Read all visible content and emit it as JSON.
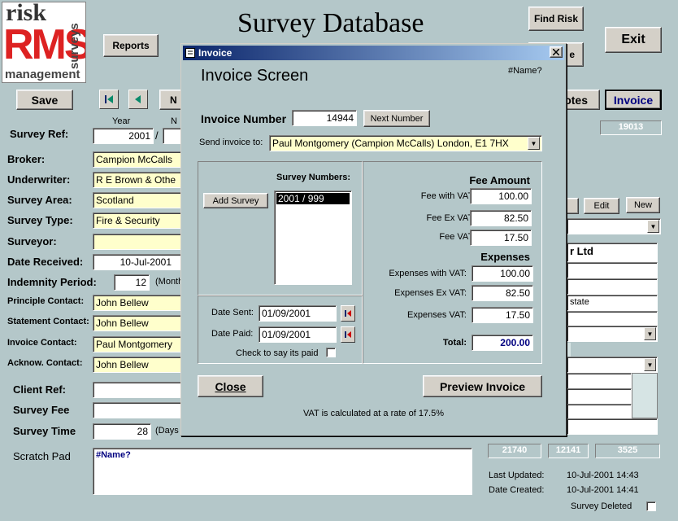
{
  "logo": {
    "line1": "risk",
    "line2": "RMS",
    "line3": "surveys",
    "line4": "management"
  },
  "header": {
    "title": "Survey Database"
  },
  "buttons": {
    "reports": "Reports",
    "find_risk": "Find Risk",
    "exit": "Exit",
    "save": "Save",
    "nav_n_partial": "N",
    "notes_partial": "otes",
    "invoice": "Invoice",
    "hidden_button_partial": "e",
    "edit": "Edit",
    "new": "New"
  },
  "form": {
    "year_label": "Year",
    "number_label_partial": "N",
    "survey_ref_label": "Survey Ref:",
    "survey_ref_year": "2001",
    "survey_ref_sep": "/",
    "ref_code": "19013",
    "broker_label": "Broker:",
    "broker_value": "Campion McCalls",
    "underwriter_label": "Underwriter:",
    "underwriter_value": "R E Brown & Othe",
    "survey_area_label": "Survey Area:",
    "survey_area_value": "Scotland",
    "survey_type_label": "Survey Type:",
    "survey_type_value": "Fire & Security",
    "surveyor_label": "Surveyor:",
    "surveyor_value": "",
    "date_received_label": "Date Received:",
    "date_received_value": "10-Jul-2001",
    "indemnity_label": "Indemnity Period:",
    "indemnity_value": "12",
    "indemnity_unit": "(Month",
    "principle_contact_label": "Principle Contact:",
    "principle_contact_value": "John Bellew",
    "statement_contact_label": "Statement Contact:",
    "statement_contact_value": "John Bellew",
    "invoice_contact_label": "Invoice Contact:",
    "invoice_contact_value": "Paul Montgomery",
    "acknow_contact_label": "Acknow. Contact:",
    "acknow_contact_value": "John Bellew",
    "client_ref_label": "Client Ref:",
    "client_ref_value": "",
    "survey_fee_label": "Survey Fee",
    "survey_fee_value": "",
    "survey_time_label": "Survey Time",
    "survey_time_value": "28",
    "survey_time_unit": "(Days",
    "scratch_pad_label": "Scratch Pad",
    "scratch_pad_value": "#Name?"
  },
  "right_panel": {
    "company_partial": "r Ltd",
    "estate_partial": "state",
    "codes": [
      "21740",
      "12141",
      "3525"
    ],
    "last_updated_label": "Last Updated:",
    "last_updated_value": "10-Jul-2001 14:43",
    "date_created_label": "Date Created:",
    "date_created_value": "10-Jul-2001 14:41",
    "survey_deleted_label": "Survey Deleted"
  },
  "dialog": {
    "window_title": "Invoice",
    "heading": "Invoice Screen",
    "name_error": "#Name?",
    "invoice_number_label": "Invoice Number",
    "invoice_number_value": "14944",
    "next_number_button": "Next Number",
    "send_to_label": "Send invoice to:",
    "send_to_value": "Paul Montgomery (Campion McCalls) London, E1 7HX",
    "survey_numbers_label": "Survey Numbers:",
    "add_survey_button": "Add Survey",
    "survey_numbers": [
      "2001 / 999"
    ],
    "fee_amount_label": "Fee Amount",
    "fee_with_vat_label": "Fee with VAT:",
    "fee_with_vat_value": "100.00",
    "fee_ex_vat_label": "Fee Ex VAT:",
    "fee_ex_vat_value": "82.50",
    "fee_vat_label": "Fee VAT:",
    "fee_vat_value": "17.50",
    "expenses_label": "Expenses",
    "exp_with_vat_label": "Expenses with VAT:",
    "exp_with_vat_value": "100.00",
    "exp_ex_vat_label": "Expenses Ex VAT:",
    "exp_ex_vat_value": "82.50",
    "exp_vat_label": "Expenses VAT:",
    "exp_vat_value": "17.50",
    "total_label": "Total:",
    "total_value": "200.00",
    "date_sent_label": "Date Sent:",
    "date_sent_value": "01/09/2001",
    "date_paid_label": "Date Paid:",
    "date_paid_value": "01/09/2001",
    "paid_check_label": "Check to say its paid",
    "close_button": "Close",
    "preview_button": "Preview Invoice",
    "vat_note": "VAT is calculated at a rate of 17.5%"
  }
}
